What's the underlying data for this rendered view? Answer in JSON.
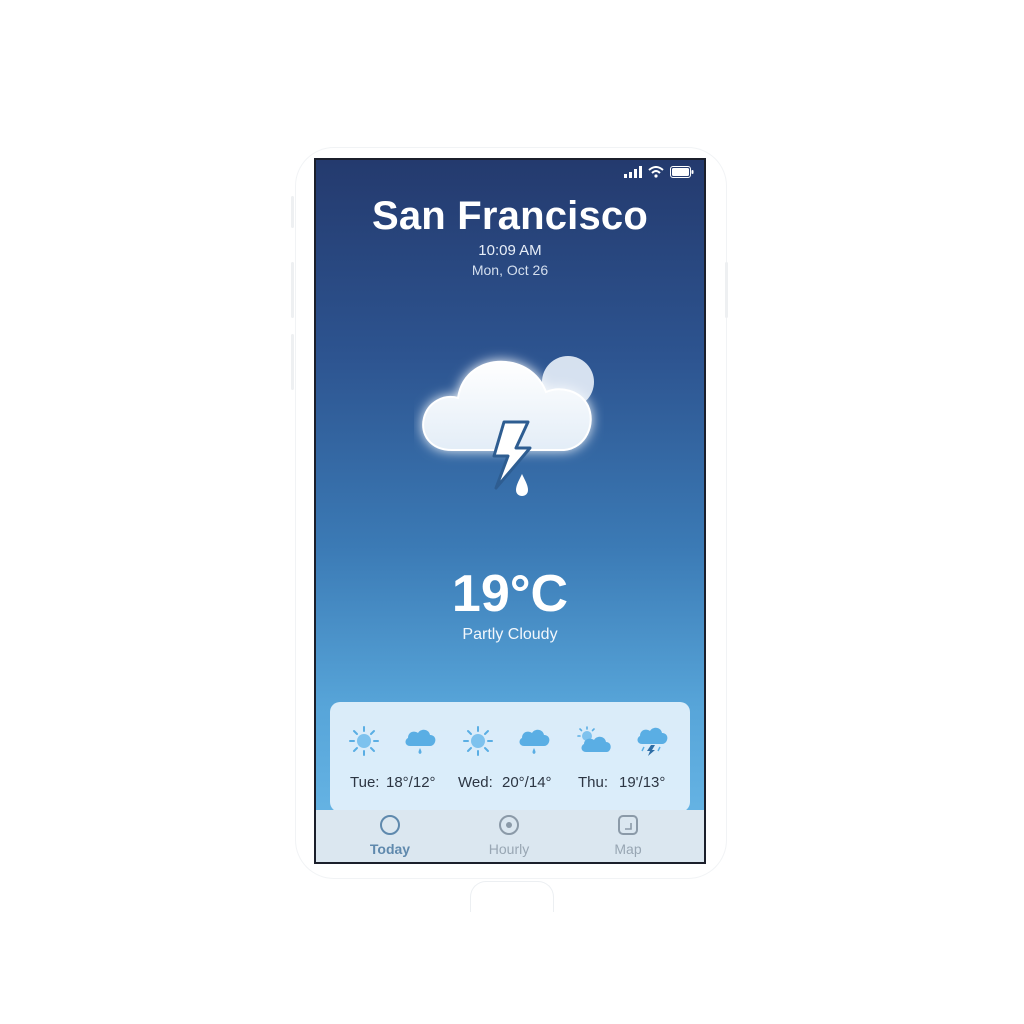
{
  "location": {
    "city": "San Francisco",
    "time": "10:09 AM",
    "date": "Mon, Oct 26"
  },
  "current": {
    "temperature": "19°C",
    "condition": "Partly Cloudy",
    "icon": "cloud-lightning-rain-icon"
  },
  "forecast": [
    {
      "day": "Tue:",
      "range": "18°/12°",
      "icons": [
        "sun-icon",
        "cloud-rain-icon"
      ]
    },
    {
      "day": "Wed:",
      "range": "20°/14°",
      "icons": [
        "sun-icon",
        "cloud-rain-icon"
      ]
    },
    {
      "day": "Thu:",
      "range": "19'/13°",
      "icons": [
        "sun-cloud-icon",
        "cloud-lightning-icon"
      ]
    }
  ],
  "tabs": [
    {
      "label": "Today",
      "icon": "circle-icon",
      "active": true
    },
    {
      "label": "Hourly",
      "icon": "dot-circle-icon",
      "active": false
    },
    {
      "label": "Map",
      "icon": "map-square-icon",
      "active": false
    }
  ],
  "colors": {
    "gradient_top": "#243a6e",
    "gradient_bottom": "#6bb9e8",
    "active_tab": "#5f89ad",
    "icon_blue": "#5aaee4"
  }
}
